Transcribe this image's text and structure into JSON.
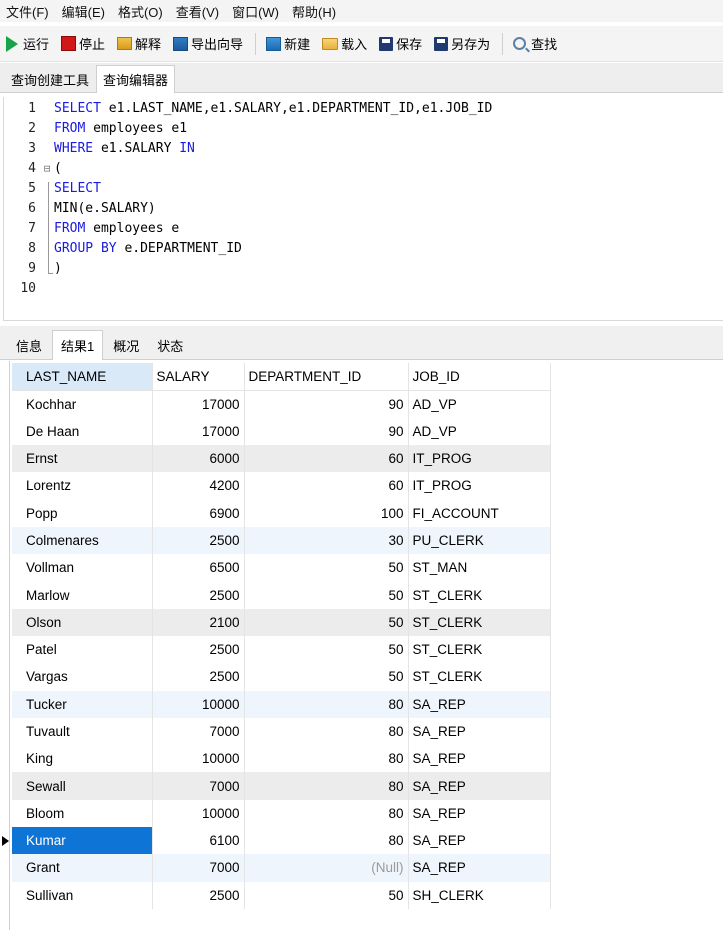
{
  "menu": [
    "文件(F)",
    "编辑(E)",
    "格式(O)",
    "查看(V)",
    "窗口(W)",
    "帮助(H)"
  ],
  "toolbar": {
    "run": "运行",
    "stop": "停止",
    "explain": "解释",
    "export_wizard": "导出向导",
    "new": "新建",
    "load": "载入",
    "save": "保存",
    "save_as": "另存为",
    "find": "查找"
  },
  "editor_tabs": [
    "查询创建工具",
    "查询编辑器"
  ],
  "active_editor_tab": "查询编辑器",
  "sql_lines": [
    "SELECT e1.LAST_NAME,e1.SALARY,e1.DEPARTMENT_ID,e1.JOB_ID",
    "FROM employees e1",
    "WHERE e1.SALARY IN",
    "(",
    "SELECT",
    "MIN(e.SALARY)",
    "FROM employees e",
    "GROUP BY e.DEPARTMENT_ID",
    ")",
    ""
  ],
  "line_numbers": [
    "1",
    "2",
    "3",
    "4",
    "5",
    "6",
    "7",
    "8",
    "9",
    "10"
  ],
  "result_tabs": [
    "信息",
    "结果1",
    "概况",
    "状态"
  ],
  "active_result_tab": "结果1",
  "table": {
    "columns": [
      "LAST_NAME",
      "SALARY",
      "DEPARTMENT_ID",
      "JOB_ID"
    ],
    "rows": [
      [
        "Kochhar",
        "17000",
        "90",
        "AD_VP"
      ],
      [
        "De Haan",
        "17000",
        "90",
        "AD_VP"
      ],
      [
        "Ernst",
        "6000",
        "60",
        "IT_PROG"
      ],
      [
        "Lorentz",
        "4200",
        "60",
        "IT_PROG"
      ],
      [
        "Popp",
        "6900",
        "100",
        "FI_ACCOUNT"
      ],
      [
        "Colmenares",
        "2500",
        "30",
        "PU_CLERK"
      ],
      [
        "Vollman",
        "6500",
        "50",
        "ST_MAN"
      ],
      [
        "Marlow",
        "2500",
        "50",
        "ST_CLERK"
      ],
      [
        "Olson",
        "2100",
        "50",
        "ST_CLERK"
      ],
      [
        "Patel",
        "2500",
        "50",
        "ST_CLERK"
      ],
      [
        "Vargas",
        "2500",
        "50",
        "ST_CLERK"
      ],
      [
        "Tucker",
        "10000",
        "80",
        "SA_REP"
      ],
      [
        "Tuvault",
        "7000",
        "80",
        "SA_REP"
      ],
      [
        "King",
        "10000",
        "80",
        "SA_REP"
      ],
      [
        "Sewall",
        "7000",
        "80",
        "SA_REP"
      ],
      [
        "Bloom",
        "10000",
        "80",
        "SA_REP"
      ],
      [
        "Kumar",
        "6100",
        "80",
        "SA_REP"
      ],
      [
        "Grant",
        "7000",
        "(Null)",
        "SA_REP"
      ],
      [
        "Sullivan",
        "2500",
        "50",
        "SH_CLERK"
      ]
    ],
    "selected_row": 16
  },
  "colors": {
    "keyword": "#1a1ae0",
    "selection": "#0e75d6",
    "row_alt_blue": "#eef5fc",
    "row_alt_gray": "#ececec",
    "header_sorted": "#d9e9f8",
    "null_text": "#9a9a9a"
  }
}
